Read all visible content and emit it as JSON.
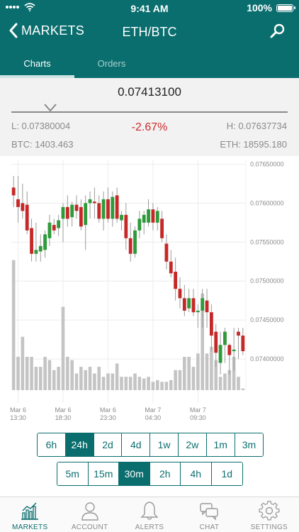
{
  "status_bar": {
    "time": "9:41 AM",
    "battery": "100%"
  },
  "nav": {
    "back_label": "MARKETS",
    "title": "ETH/BTC",
    "back_icon": "chevron-left-icon",
    "search_icon": "search-icon"
  },
  "tabs": [
    {
      "label": "Charts",
      "active": true
    },
    {
      "label": "Orders",
      "active": false
    }
  ],
  "ticker": {
    "last_price": "0.07413100",
    "low": "L: 0.07380004",
    "change": "-2.67%",
    "high": "H: 0.07637734",
    "btc_volume": "BTC: 1403.463",
    "eth_volume": "ETH: 18595.180"
  },
  "colors": {
    "primary": "#0b6e6e",
    "up": "#2e9a3a",
    "down": "#c62828",
    "volume": "#c4c4c4",
    "negative_text": "#cc2a2a"
  },
  "chart_data": {
    "type": "candlestick",
    "grid": true,
    "y_axis_position": "right",
    "ylim": [
      0.0736,
      0.07655
    ],
    "y_ticks": [
      "0.07650000",
      "0.07600000",
      "0.07550000",
      "0.07500000",
      "0.07450000",
      "0.07400000"
    ],
    "x_ticks": [
      {
        "line1": "Mar 6",
        "line2": "13:30",
        "index": 1
      },
      {
        "line1": "Mar 6",
        "line2": "18:30",
        "index": 11
      },
      {
        "line1": "Mar 6",
        "line2": "23:30",
        "index": 21
      },
      {
        "line1": "Mar 7",
        "line2": "04:30",
        "index": 31
      },
      {
        "line1": "Mar 7",
        "line2": "09:30",
        "index": 41
      }
    ],
    "volume_max": 1.0,
    "candles": [
      {
        "o": 0.0762,
        "h": 0.07635,
        "l": 0.07595,
        "c": 0.0761,
        "v": 0.78
      },
      {
        "o": 0.07605,
        "h": 0.07635,
        "l": 0.07575,
        "c": 0.07595,
        "v": 0.2
      },
      {
        "o": 0.076,
        "h": 0.07625,
        "l": 0.0758,
        "c": 0.0759,
        "v": 0.32
      },
      {
        "o": 0.07598,
        "h": 0.07615,
        "l": 0.0756,
        "c": 0.07565,
        "v": 0.2
      },
      {
        "o": 0.07568,
        "h": 0.0758,
        "l": 0.07525,
        "c": 0.07535,
        "v": 0.2
      },
      {
        "o": 0.07535,
        "h": 0.07575,
        "l": 0.07525,
        "c": 0.0754,
        "v": 0.14
      },
      {
        "o": 0.07538,
        "h": 0.0756,
        "l": 0.07525,
        "c": 0.07545,
        "v": 0.14
      },
      {
        "o": 0.0754,
        "h": 0.07565,
        "l": 0.0753,
        "c": 0.0756,
        "v": 0.2
      },
      {
        "o": 0.07555,
        "h": 0.07585,
        "l": 0.07545,
        "c": 0.07575,
        "v": 0.18
      },
      {
        "o": 0.07572,
        "h": 0.0758,
        "l": 0.0756,
        "c": 0.07565,
        "v": 0.12
      },
      {
        "o": 0.07568,
        "h": 0.07585,
        "l": 0.07558,
        "c": 0.07578,
        "v": 0.14
      },
      {
        "o": 0.0758,
        "h": 0.076,
        "l": 0.0755,
        "c": 0.07595,
        "v": 0.5
      },
      {
        "o": 0.07595,
        "h": 0.0761,
        "l": 0.0757,
        "c": 0.0758,
        "v": 0.2
      },
      {
        "o": 0.07582,
        "h": 0.07602,
        "l": 0.0757,
        "c": 0.07598,
        "v": 0.18
      },
      {
        "o": 0.07598,
        "h": 0.0761,
        "l": 0.0758,
        "c": 0.0759,
        "v": 0.1
      },
      {
        "o": 0.07595,
        "h": 0.07605,
        "l": 0.07565,
        "c": 0.0757,
        "v": 0.14
      },
      {
        "o": 0.07572,
        "h": 0.0761,
        "l": 0.0754,
        "c": 0.076,
        "v": 0.12
      },
      {
        "o": 0.076,
        "h": 0.07615,
        "l": 0.0758,
        "c": 0.07605,
        "v": 0.14
      },
      {
        "o": 0.07602,
        "h": 0.0762,
        "l": 0.0758,
        "c": 0.076,
        "v": 0.1
      },
      {
        "o": 0.076,
        "h": 0.0761,
        "l": 0.07575,
        "c": 0.0758,
        "v": 0.14
      },
      {
        "o": 0.0758,
        "h": 0.07615,
        "l": 0.07565,
        "c": 0.07605,
        "v": 0.08
      },
      {
        "o": 0.07605,
        "h": 0.0762,
        "l": 0.07575,
        "c": 0.0758,
        "v": 0.1
      },
      {
        "o": 0.0758,
        "h": 0.07615,
        "l": 0.0757,
        "c": 0.07608,
        "v": 0.1
      },
      {
        "o": 0.0761,
        "h": 0.0762,
        "l": 0.07575,
        "c": 0.0758,
        "v": 0.16
      },
      {
        "o": 0.07578,
        "h": 0.0759,
        "l": 0.07565,
        "c": 0.07585,
        "v": 0.08
      },
      {
        "o": 0.07585,
        "h": 0.076,
        "l": 0.0754,
        "c": 0.07555,
        "v": 0.08
      },
      {
        "o": 0.07555,
        "h": 0.07575,
        "l": 0.07525,
        "c": 0.07535,
        "v": 0.08
      },
      {
        "o": 0.07535,
        "h": 0.0757,
        "l": 0.0753,
        "c": 0.07565,
        "v": 0.1
      },
      {
        "o": 0.07565,
        "h": 0.0759,
        "l": 0.07555,
        "c": 0.0758,
        "v": 0.08
      },
      {
        "o": 0.07575,
        "h": 0.0759,
        "l": 0.0756,
        "c": 0.07585,
        "v": 0.07
      },
      {
        "o": 0.07575,
        "h": 0.07605,
        "l": 0.0757,
        "c": 0.07592,
        "v": 0.08
      },
      {
        "o": 0.07592,
        "h": 0.076,
        "l": 0.07565,
        "c": 0.07575,
        "v": 0.05
      },
      {
        "o": 0.07575,
        "h": 0.07595,
        "l": 0.07565,
        "c": 0.0759,
        "v": 0.06
      },
      {
        "o": 0.0758,
        "h": 0.0759,
        "l": 0.0755,
        "c": 0.07555,
        "v": 0.05
      },
      {
        "o": 0.07548,
        "h": 0.0756,
        "l": 0.07515,
        "c": 0.07525,
        "v": 0.05
      },
      {
        "o": 0.07525,
        "h": 0.0754,
        "l": 0.07505,
        "c": 0.0751,
        "v": 0.06
      },
      {
        "o": 0.07512,
        "h": 0.0753,
        "l": 0.07475,
        "c": 0.0749,
        "v": 0.12
      },
      {
        "o": 0.0749,
        "h": 0.07505,
        "l": 0.07465,
        "c": 0.07478,
        "v": 0.12
      },
      {
        "o": 0.07478,
        "h": 0.07495,
        "l": 0.07455,
        "c": 0.07462,
        "v": 0.2
      },
      {
        "o": 0.07465,
        "h": 0.0749,
        "l": 0.0746,
        "c": 0.07478,
        "v": 0.2
      },
      {
        "o": 0.07478,
        "h": 0.0749,
        "l": 0.07455,
        "c": 0.0746,
        "v": 0.14
      },
      {
        "o": 0.0746,
        "h": 0.0747,
        "l": 0.0744,
        "c": 0.07462,
        "v": 0.22
      },
      {
        "o": 0.07462,
        "h": 0.0749,
        "l": 0.0744,
        "c": 0.07478,
        "v": 0.58
      },
      {
        "o": 0.07475,
        "h": 0.0749,
        "l": 0.0744,
        "c": 0.0746,
        "v": 0.22
      },
      {
        "o": 0.0746,
        "h": 0.0747,
        "l": 0.0741,
        "c": 0.0743,
        "v": 0.26
      },
      {
        "o": 0.07435,
        "h": 0.07445,
        "l": 0.0739,
        "c": 0.07408,
        "v": 0.18
      },
      {
        "o": 0.07395,
        "h": 0.07435,
        "l": 0.0738,
        "c": 0.07418,
        "v": 0.08
      },
      {
        "o": 0.07418,
        "h": 0.0744,
        "l": 0.07395,
        "c": 0.07435,
        "v": 0.1
      },
      {
        "o": 0.07418,
        "h": 0.0742,
        "l": 0.0738,
        "c": 0.07405,
        "v": 0.12
      },
      {
        "o": 0.0741,
        "h": 0.0744,
        "l": 0.07385,
        "c": 0.07412,
        "v": 0.2
      },
      {
        "o": 0.07435,
        "h": 0.0744,
        "l": 0.074,
        "c": 0.0743,
        "v": 0.08
      },
      {
        "o": 0.0743,
        "h": 0.0744,
        "l": 0.07405,
        "c": 0.0741,
        "v": 0.01
      }
    ]
  },
  "intervals_row1": [
    "6h",
    "24h",
    "2d",
    "4d",
    "1w",
    "2w",
    "1m",
    "3m"
  ],
  "intervals_row1_selected": "24h",
  "intervals_row2": [
    "5m",
    "15m",
    "30m",
    "2h",
    "4h",
    "1d"
  ],
  "intervals_row2_selected": "30m",
  "tabbar": [
    {
      "label": "MARKETS",
      "icon": "bar-chart-icon",
      "active": true
    },
    {
      "label": "ACCOUNT",
      "icon": "user-icon",
      "active": false
    },
    {
      "label": "ALERTS",
      "icon": "bell-icon",
      "active": false
    },
    {
      "label": "CHAT",
      "icon": "chat-bubbles-icon",
      "active": false
    },
    {
      "label": "SETTINGS",
      "icon": "gear-icon",
      "active": false
    }
  ]
}
